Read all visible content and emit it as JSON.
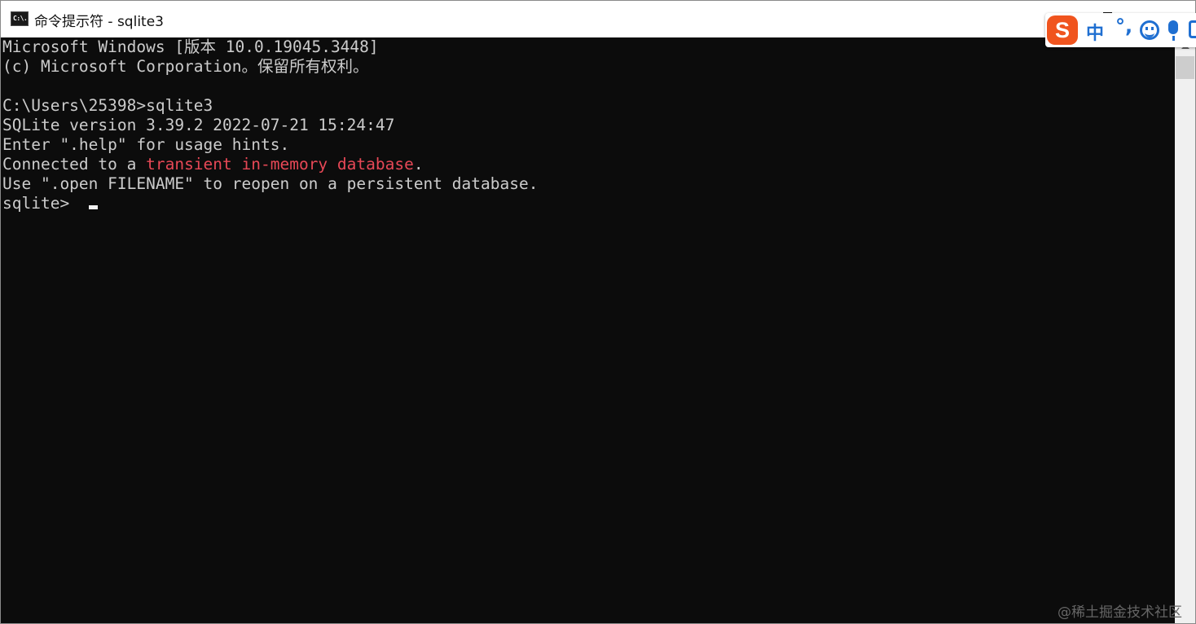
{
  "window": {
    "title": "命令提示符 - sqlite3",
    "app_icon_text": "C:\\."
  },
  "ime_toolbar": {
    "logo": "S",
    "language": "中",
    "punctuation": "°,",
    "icons": [
      "sogou-logo-icon",
      "emoji-icon",
      "microphone-icon",
      "more-icon"
    ]
  },
  "console": {
    "lines": [
      {
        "text": "Microsoft Windows [版本 10.0.19045.3448]"
      },
      {
        "text": "(c) Microsoft Corporation。保留所有权利。"
      },
      {
        "text": ""
      },
      {
        "text": "C:\\Users\\25398>sqlite3"
      },
      {
        "text": "SQLite version 3.39.2 2022-07-21 15:24:47"
      },
      {
        "text": "Enter \".help\" for usage hints."
      },
      {
        "prefix": "Connected to a ",
        "highlight": "transient in-memory database",
        "suffix": "."
      },
      {
        "text": "Use \".open FILENAME\" to reopen on a persistent database."
      },
      {
        "text": "sqlite> "
      }
    ],
    "colors": {
      "background": "#0c0c0c",
      "foreground": "#cccccc",
      "highlight": "#e74856"
    }
  },
  "watermark": "@稀土掘金技术社区"
}
